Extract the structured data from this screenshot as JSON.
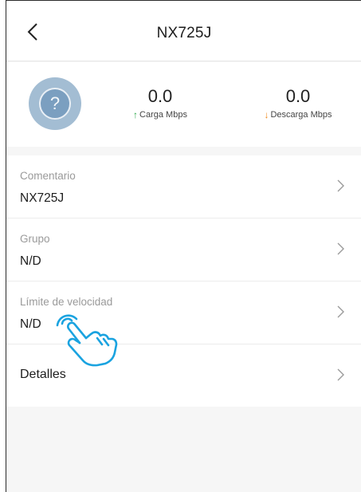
{
  "header": {
    "title": "NX725J"
  },
  "stats": {
    "upload_value": "0.0",
    "upload_label": "Carga Mbps",
    "download_value": "0.0",
    "download_label": "Descarga Mbps"
  },
  "list": {
    "items": [
      {
        "label": "Comentario",
        "value": "NX725J"
      },
      {
        "label": "Grupo",
        "value": "N/D"
      },
      {
        "label": "Límite de velocidad",
        "value": "N/D"
      }
    ],
    "details_label": "Detalles"
  },
  "icons": {
    "back": "chevron-left-icon",
    "device": "unknown-device-icon",
    "upload": "arrow-up-icon",
    "download": "arrow-down-icon",
    "row": "chevron-right-icon",
    "pointer": "tap-hand-icon"
  },
  "colors": {
    "upload_arrow": "#2aa84a",
    "download_arrow": "#f08a1c",
    "device_icon": "#7b9fc0",
    "tap_hand": "#1aa3e0"
  }
}
